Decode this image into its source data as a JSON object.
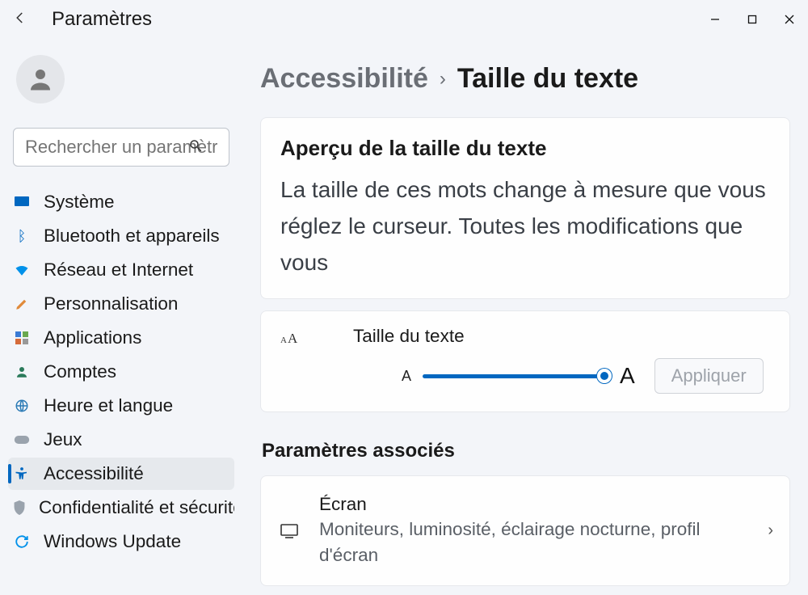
{
  "window": {
    "title": "Paramètres"
  },
  "search": {
    "placeholder": "Rechercher un paramètre"
  },
  "sidebar": {
    "items": [
      {
        "label": "Système"
      },
      {
        "label": "Bluetooth et appareils"
      },
      {
        "label": "Réseau et Internet"
      },
      {
        "label": "Personnalisation"
      },
      {
        "label": "Applications"
      },
      {
        "label": "Comptes"
      },
      {
        "label": "Heure et langue"
      },
      {
        "label": "Jeux"
      },
      {
        "label": "Accessibilité"
      },
      {
        "label": "Confidentialité et sécurité"
      },
      {
        "label": "Windows Update"
      }
    ]
  },
  "breadcrumb": {
    "parent": "Accessibilité",
    "current": "Taille du texte"
  },
  "preview": {
    "heading": "Aperçu de la taille du texte",
    "text": "La taille de ces mots change à mesure que vous réglez le curseur. Toutes les modifications que vous"
  },
  "slider": {
    "label": "Taille du texte",
    "min_marker": "A",
    "max_marker": "A",
    "apply": "Appliquer"
  },
  "related": {
    "heading": "Paramètres associés",
    "item": {
      "title": "Écran",
      "subtitle": "Moniteurs, luminosité, éclairage nocturne, profil d'écran"
    }
  }
}
